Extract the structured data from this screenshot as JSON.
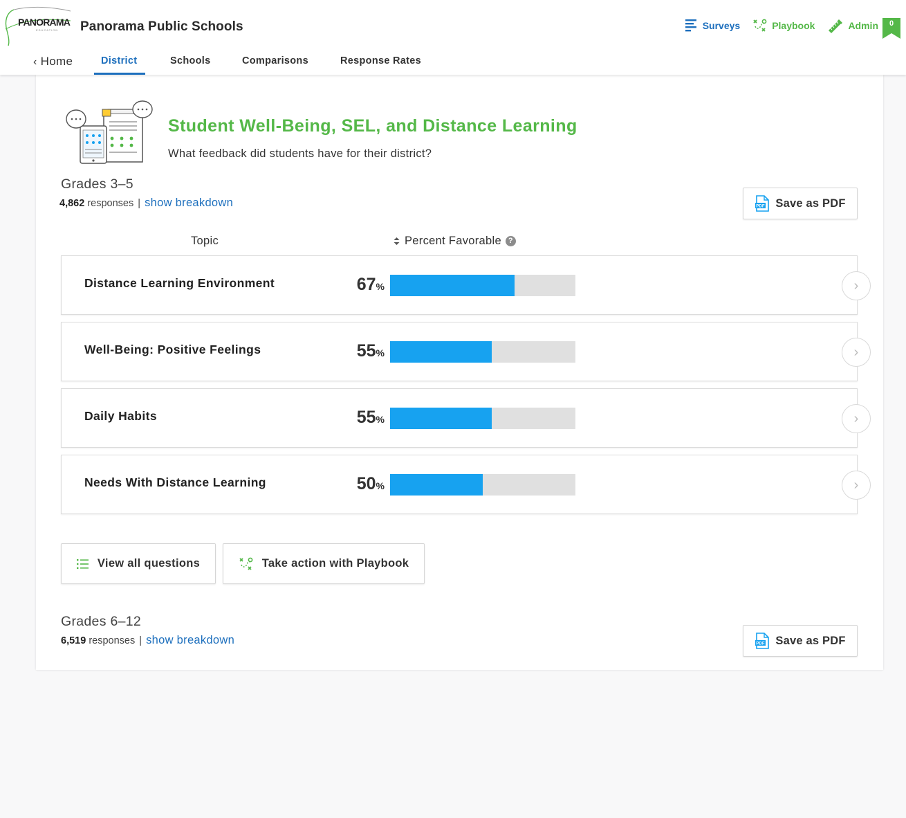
{
  "header": {
    "logo_text": "PANORAMA",
    "logo_sub": "EDUCATION",
    "org_name": "Panorama Public Schools",
    "links": [
      {
        "label": "Surveys",
        "icon": "bars-icon"
      },
      {
        "label": "Playbook",
        "icon": "playbook-icon"
      },
      {
        "label": "Admin",
        "icon": "ruler-pencil-icon"
      }
    ],
    "notification_count": "0",
    "brand_green": "#54b848",
    "brand_blue": "#1d6fbd"
  },
  "nav": {
    "home": "Home",
    "tabs": [
      "District",
      "Schools",
      "Comparisons",
      "Response Rates"
    ],
    "active_tab": "District"
  },
  "survey": {
    "title": "Student Well-Being, SEL, and Distance Learning",
    "subtitle": "What feedback did students have for their district?"
  },
  "sections": [
    {
      "grade": "Grades 3–5",
      "count": "4,862",
      "responses_label": "responses",
      "separator": "|",
      "breakdown_link": "show breakdown",
      "pdf_label": "Save as PDF"
    },
    {
      "grade": "Grades 6–12",
      "count": "6,519",
      "responses_label": "responses",
      "separator": "|",
      "breakdown_link": "show breakdown",
      "pdf_label": "Save as PDF"
    }
  ],
  "table": {
    "col_topic": "Topic",
    "col_percent": "Percent Favorable",
    "help": "?",
    "percent_symbol": "%",
    "bar_color": "#17a2f0",
    "rows": [
      {
        "topic": "Distance Learning Environment",
        "value": "67",
        "fraction": 0.67
      },
      {
        "topic": "Well-Being: Positive Feelings",
        "value": "55",
        "fraction": 0.55
      },
      {
        "topic": "Daily Habits",
        "value": "55",
        "fraction": 0.55
      },
      {
        "topic": "Needs With Distance Learning",
        "value": "50",
        "fraction": 0.5
      }
    ]
  },
  "actions": {
    "view_questions": "View all questions",
    "playbook": "Take action with Playbook"
  }
}
